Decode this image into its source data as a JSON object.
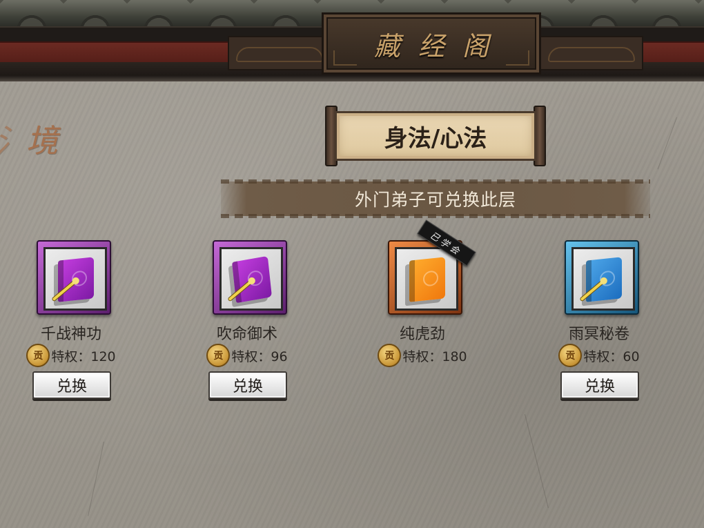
{
  "header": {
    "title": "藏经阁"
  },
  "side_text": "境",
  "section": {
    "title": "身法/心法",
    "subtitle": "外门弟子可兑换此层"
  },
  "items": [
    {
      "name": "千战神功",
      "coin_glyph": "贡",
      "cost_label": "特权：120",
      "button": "兑换",
      "rarity_color": "#b24bd1",
      "learned": false
    },
    {
      "name": "吹命御术",
      "coin_glyph": "贡",
      "cost_label": "特权：96",
      "button": "兑换",
      "rarity_color": "#b24bd1",
      "learned": false
    },
    {
      "name": "纯虎劲",
      "coin_glyph": "贡",
      "cost_label": "特权：180",
      "tag": "已学会",
      "rarity_color": "#e07b2a",
      "learned": true
    },
    {
      "name": "雨冥秘卷",
      "coin_glyph": "贡",
      "cost_label": "特权：60",
      "button": "兑换",
      "rarity_color": "#3fa3d6",
      "learned": false
    }
  ]
}
